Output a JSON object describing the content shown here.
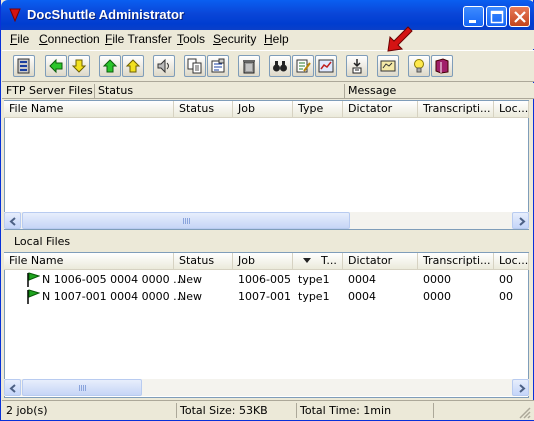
{
  "window": {
    "title": "DocShuttle Administrator"
  },
  "menu": {
    "items": [
      {
        "label": "File",
        "u": "F",
        "rest": "ile"
      },
      {
        "label": "Connection",
        "u": "C",
        "rest": "onnection"
      },
      {
        "label": "File Transfer",
        "u": "F",
        "rest": "ile Transfer"
      },
      {
        "label": "Tools",
        "u": "T",
        "rest": "ools"
      },
      {
        "label": "Security",
        "u": "S",
        "rest": "ecurity"
      },
      {
        "label": "Help",
        "u": "H",
        "rest": "elp"
      }
    ]
  },
  "header_strip": {
    "ftp_label": "FTP Server Files",
    "status_label": "Status",
    "message_label": "Message"
  },
  "ftp_list": {
    "columns": [
      "File Name",
      "Status",
      "Job",
      "Type",
      "Dictator",
      "Transcripti...",
      "Loc..."
    ]
  },
  "local_files": {
    "label": "Local Files",
    "columns": [
      "File Name",
      "Status",
      "Job",
      "T...",
      "Dictator",
      "Transcripti...",
      "Loc..."
    ],
    "rows": [
      {
        "file_name": "N 1006-005 0004 0000 ...",
        "status": "New",
        "job": "1006-005",
        "type": "type1",
        "dictator": "0004",
        "transcriptionist": "0000",
        "loc": "00"
      },
      {
        "file_name": "N 1007-001 0004 0000 ...",
        "status": "New",
        "job": "1007-001",
        "type": "type1",
        "dictator": "0004",
        "transcriptionist": "0000",
        "loc": "00"
      }
    ]
  },
  "status_bar": {
    "jobs": "2 job(s)",
    "total_size": "Total Size:  53KB",
    "total_time": "Total Time:  1min"
  },
  "colors": {
    "title_bar": "#0a46d8",
    "close_button": "#c4441c",
    "flag_green": "#1fa41f",
    "pointer_arrow": "#d41313"
  }
}
